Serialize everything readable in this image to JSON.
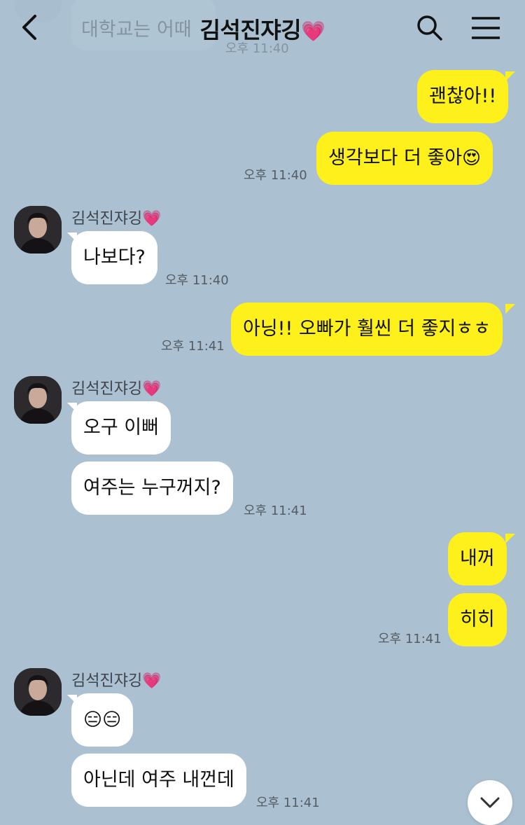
{
  "header": {
    "title": "김석진쟈깅",
    "title_emoji": "💗",
    "back_icon": "chevron-left-icon",
    "search_icon": "search-icon",
    "menu_icon": "hamburger-menu-icon"
  },
  "colors": {
    "background": "#abc1d1",
    "my_bubble": "#fef01b",
    "their_bubble": "#ffffff"
  },
  "faded_message": {
    "text": "대학교는 어때",
    "time": "오후 11:40"
  },
  "messages": [
    {
      "from": "me",
      "text": "괜찮아!!"
    },
    {
      "from": "me",
      "text": "생각보다 더 좋아",
      "emoji": "😍",
      "time": "오후 11:40"
    },
    {
      "from": "them",
      "sender": "김석진쟈깅",
      "sender_emoji": "💗",
      "text": "나보다?",
      "time": "오후 11:40"
    },
    {
      "from": "me",
      "text": "아닝!! 오빠가 훨씬 더 좋지ㅎㅎ",
      "time": "오후 11:41"
    },
    {
      "from": "them",
      "sender": "김석진쟈깅",
      "sender_emoji": "💗",
      "text": "오구 이뻐"
    },
    {
      "from": "them",
      "text": "여주는 누구꺼지?",
      "time": "오후 11:41"
    },
    {
      "from": "me",
      "text": "내꺼"
    },
    {
      "from": "me",
      "text": "히히",
      "time": "오후 11:41"
    },
    {
      "from": "them",
      "sender": "김석진쟈깅",
      "sender_emoji": "💗",
      "text": "😑😑"
    },
    {
      "from": "them",
      "text": "아닌데 여주 내껀데",
      "time": "오후 11:41"
    }
  ],
  "scroll_button_icon": "chevron-down-icon"
}
